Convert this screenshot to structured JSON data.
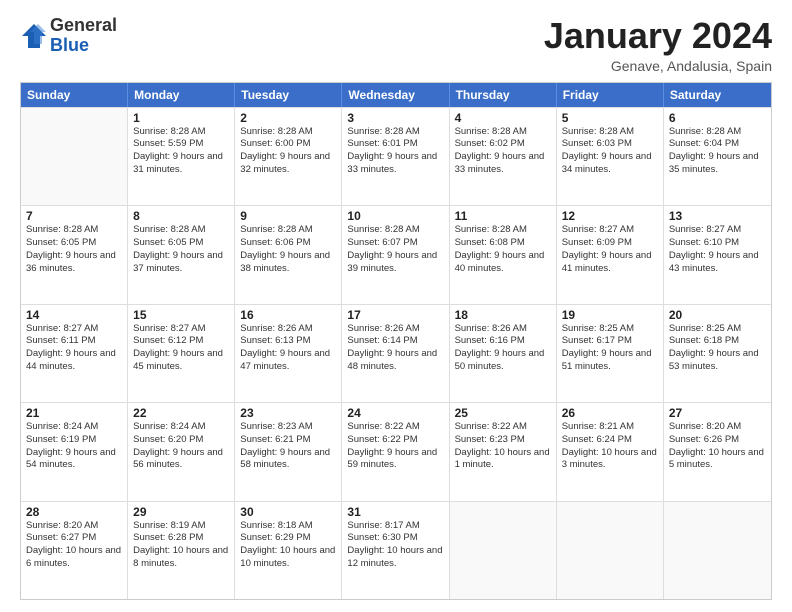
{
  "header": {
    "logo_general": "General",
    "logo_blue": "Blue",
    "month_title": "January 2024",
    "location": "Genave, Andalusia, Spain"
  },
  "calendar": {
    "days": [
      "Sunday",
      "Monday",
      "Tuesday",
      "Wednesday",
      "Thursday",
      "Friday",
      "Saturday"
    ],
    "weeks": [
      [
        {
          "day": "",
          "empty": true
        },
        {
          "day": "1",
          "sunrise": "Sunrise: 8:28 AM",
          "sunset": "Sunset: 5:59 PM",
          "daylight": "Daylight: 9 hours and 31 minutes."
        },
        {
          "day": "2",
          "sunrise": "Sunrise: 8:28 AM",
          "sunset": "Sunset: 6:00 PM",
          "daylight": "Daylight: 9 hours and 32 minutes."
        },
        {
          "day": "3",
          "sunrise": "Sunrise: 8:28 AM",
          "sunset": "Sunset: 6:01 PM",
          "daylight": "Daylight: 9 hours and 33 minutes."
        },
        {
          "day": "4",
          "sunrise": "Sunrise: 8:28 AM",
          "sunset": "Sunset: 6:02 PM",
          "daylight": "Daylight: 9 hours and 33 minutes."
        },
        {
          "day": "5",
          "sunrise": "Sunrise: 8:28 AM",
          "sunset": "Sunset: 6:03 PM",
          "daylight": "Daylight: 9 hours and 34 minutes."
        },
        {
          "day": "6",
          "sunrise": "Sunrise: 8:28 AM",
          "sunset": "Sunset: 6:04 PM",
          "daylight": "Daylight: 9 hours and 35 minutes."
        }
      ],
      [
        {
          "day": "7",
          "sunrise": "Sunrise: 8:28 AM",
          "sunset": "Sunset: 6:05 PM",
          "daylight": "Daylight: 9 hours and 36 minutes."
        },
        {
          "day": "8",
          "sunrise": "Sunrise: 8:28 AM",
          "sunset": "Sunset: 6:05 PM",
          "daylight": "Daylight: 9 hours and 37 minutes."
        },
        {
          "day": "9",
          "sunrise": "Sunrise: 8:28 AM",
          "sunset": "Sunset: 6:06 PM",
          "daylight": "Daylight: 9 hours and 38 minutes."
        },
        {
          "day": "10",
          "sunrise": "Sunrise: 8:28 AM",
          "sunset": "Sunset: 6:07 PM",
          "daylight": "Daylight: 9 hours and 39 minutes."
        },
        {
          "day": "11",
          "sunrise": "Sunrise: 8:28 AM",
          "sunset": "Sunset: 6:08 PM",
          "daylight": "Daylight: 9 hours and 40 minutes."
        },
        {
          "day": "12",
          "sunrise": "Sunrise: 8:27 AM",
          "sunset": "Sunset: 6:09 PM",
          "daylight": "Daylight: 9 hours and 41 minutes."
        },
        {
          "day": "13",
          "sunrise": "Sunrise: 8:27 AM",
          "sunset": "Sunset: 6:10 PM",
          "daylight": "Daylight: 9 hours and 43 minutes."
        }
      ],
      [
        {
          "day": "14",
          "sunrise": "Sunrise: 8:27 AM",
          "sunset": "Sunset: 6:11 PM",
          "daylight": "Daylight: 9 hours and 44 minutes."
        },
        {
          "day": "15",
          "sunrise": "Sunrise: 8:27 AM",
          "sunset": "Sunset: 6:12 PM",
          "daylight": "Daylight: 9 hours and 45 minutes."
        },
        {
          "day": "16",
          "sunrise": "Sunrise: 8:26 AM",
          "sunset": "Sunset: 6:13 PM",
          "daylight": "Daylight: 9 hours and 47 minutes."
        },
        {
          "day": "17",
          "sunrise": "Sunrise: 8:26 AM",
          "sunset": "Sunset: 6:14 PM",
          "daylight": "Daylight: 9 hours and 48 minutes."
        },
        {
          "day": "18",
          "sunrise": "Sunrise: 8:26 AM",
          "sunset": "Sunset: 6:16 PM",
          "daylight": "Daylight: 9 hours and 50 minutes."
        },
        {
          "day": "19",
          "sunrise": "Sunrise: 8:25 AM",
          "sunset": "Sunset: 6:17 PM",
          "daylight": "Daylight: 9 hours and 51 minutes."
        },
        {
          "day": "20",
          "sunrise": "Sunrise: 8:25 AM",
          "sunset": "Sunset: 6:18 PM",
          "daylight": "Daylight: 9 hours and 53 minutes."
        }
      ],
      [
        {
          "day": "21",
          "sunrise": "Sunrise: 8:24 AM",
          "sunset": "Sunset: 6:19 PM",
          "daylight": "Daylight: 9 hours and 54 minutes."
        },
        {
          "day": "22",
          "sunrise": "Sunrise: 8:24 AM",
          "sunset": "Sunset: 6:20 PM",
          "daylight": "Daylight: 9 hours and 56 minutes."
        },
        {
          "day": "23",
          "sunrise": "Sunrise: 8:23 AM",
          "sunset": "Sunset: 6:21 PM",
          "daylight": "Daylight: 9 hours and 58 minutes."
        },
        {
          "day": "24",
          "sunrise": "Sunrise: 8:22 AM",
          "sunset": "Sunset: 6:22 PM",
          "daylight": "Daylight: 9 hours and 59 minutes."
        },
        {
          "day": "25",
          "sunrise": "Sunrise: 8:22 AM",
          "sunset": "Sunset: 6:23 PM",
          "daylight": "Daylight: 10 hours and 1 minute."
        },
        {
          "day": "26",
          "sunrise": "Sunrise: 8:21 AM",
          "sunset": "Sunset: 6:24 PM",
          "daylight": "Daylight: 10 hours and 3 minutes."
        },
        {
          "day": "27",
          "sunrise": "Sunrise: 8:20 AM",
          "sunset": "Sunset: 6:26 PM",
          "daylight": "Daylight: 10 hours and 5 minutes."
        }
      ],
      [
        {
          "day": "28",
          "sunrise": "Sunrise: 8:20 AM",
          "sunset": "Sunset: 6:27 PM",
          "daylight": "Daylight: 10 hours and 6 minutes."
        },
        {
          "day": "29",
          "sunrise": "Sunrise: 8:19 AM",
          "sunset": "Sunset: 6:28 PM",
          "daylight": "Daylight: 10 hours and 8 minutes."
        },
        {
          "day": "30",
          "sunrise": "Sunrise: 8:18 AM",
          "sunset": "Sunset: 6:29 PM",
          "daylight": "Daylight: 10 hours and 10 minutes."
        },
        {
          "day": "31",
          "sunrise": "Sunrise: 8:17 AM",
          "sunset": "Sunset: 6:30 PM",
          "daylight": "Daylight: 10 hours and 12 minutes."
        },
        {
          "day": "",
          "empty": true
        },
        {
          "day": "",
          "empty": true
        },
        {
          "day": "",
          "empty": true
        }
      ]
    ]
  }
}
